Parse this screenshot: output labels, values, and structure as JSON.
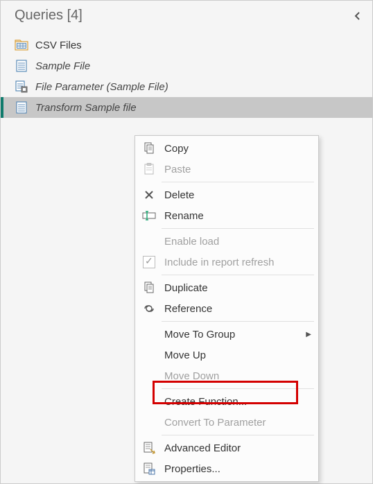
{
  "panel": {
    "title": "Queries [4]"
  },
  "queries": [
    {
      "label": "CSV Files",
      "kind": "folder",
      "italic": false
    },
    {
      "label": "Sample File",
      "kind": "file",
      "italic": true
    },
    {
      "label": "File Parameter (Sample File)",
      "kind": "param",
      "italic": true
    },
    {
      "label": "Transform Sample file",
      "kind": "file",
      "italic": true
    }
  ],
  "menu": {
    "copy": "Copy",
    "paste": "Paste",
    "delete": "Delete",
    "rename": "Rename",
    "enable_load": "Enable load",
    "include_refresh": "Include in report refresh",
    "duplicate": "Duplicate",
    "reference": "Reference",
    "move_group": "Move To Group",
    "move_up": "Move Up",
    "move_down": "Move Down",
    "create_function": "Create Function...",
    "convert_param": "Convert To Parameter",
    "advanced_editor": "Advanced Editor",
    "properties": "Properties..."
  }
}
